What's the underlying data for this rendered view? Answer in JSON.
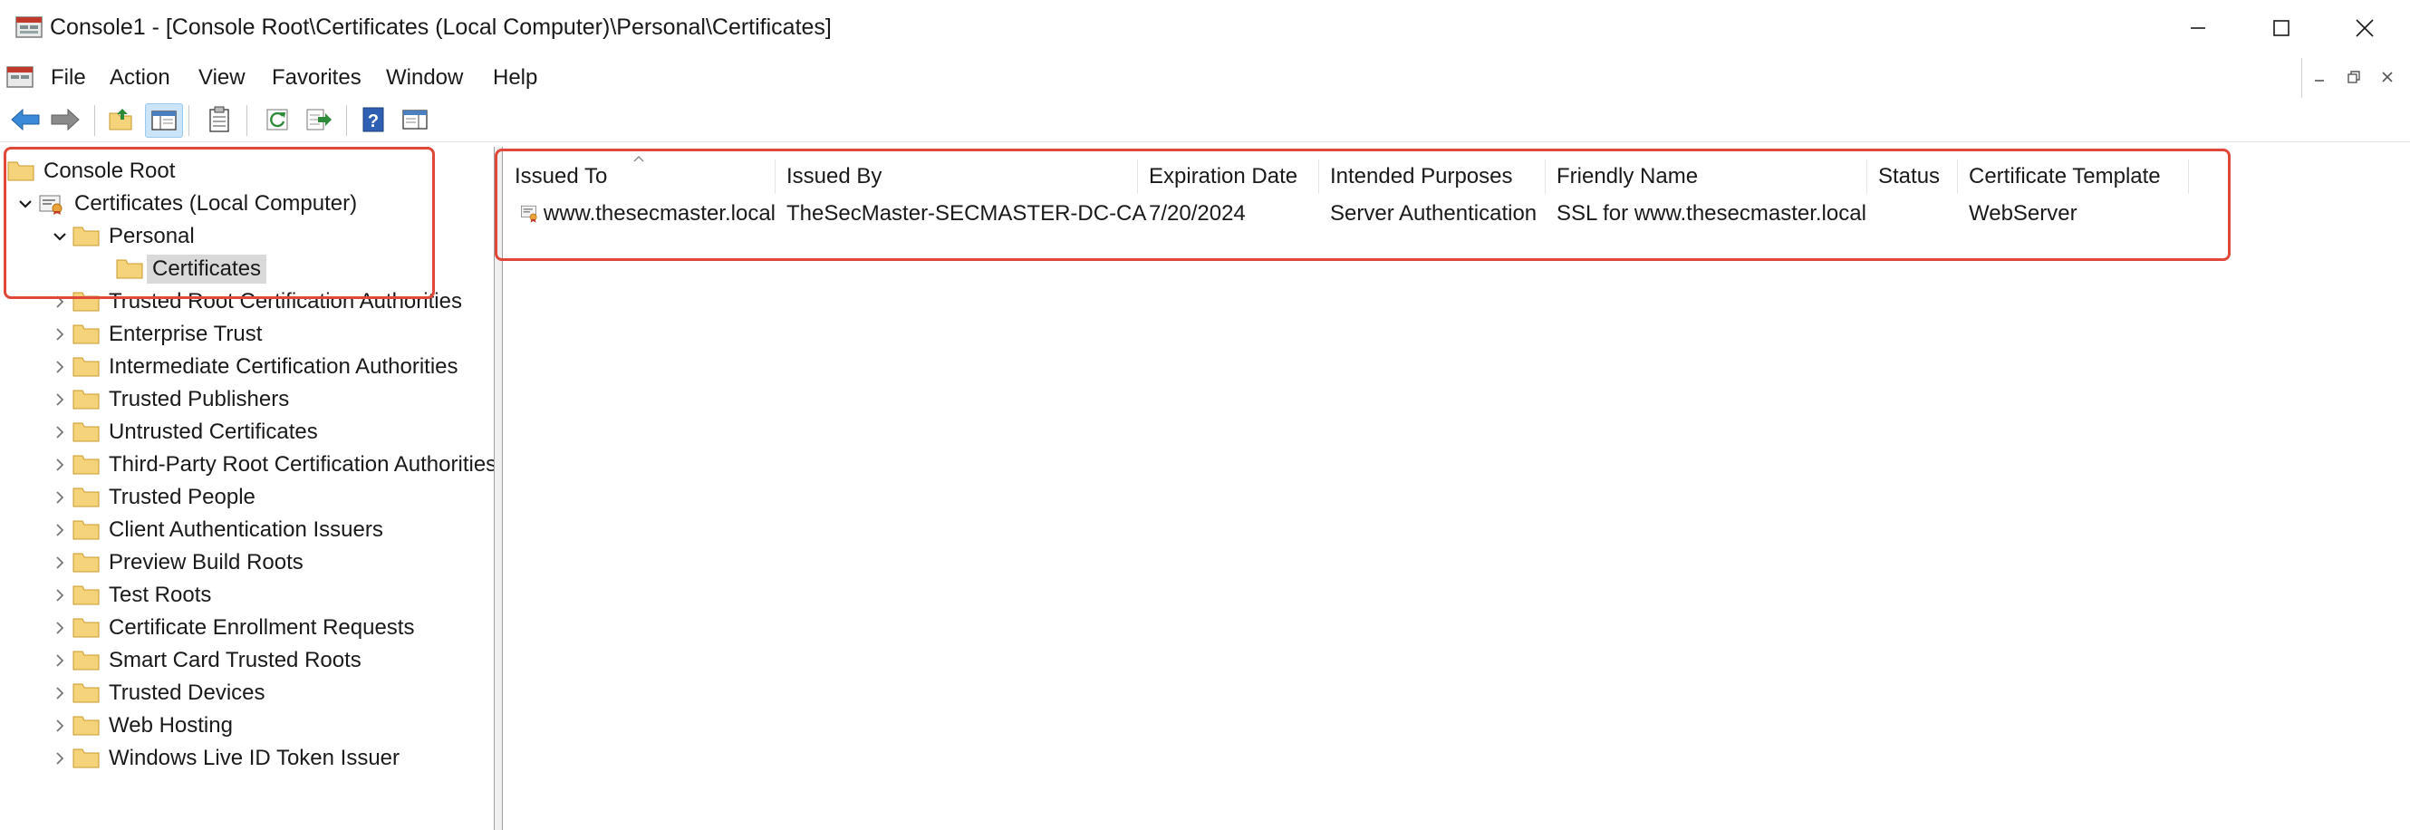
{
  "window": {
    "title": "Console1 - [Console Root\\Certificates (Local Computer)\\Personal\\Certificates]",
    "minimize_glyph": "—",
    "maximize_glyph": "☐",
    "close_glyph": "✕"
  },
  "menu": {
    "items": [
      "File",
      "Action",
      "View",
      "Favorites",
      "Window",
      "Help"
    ],
    "mdi_minimize": "–",
    "mdi_restore": "🗗",
    "mdi_close": "✕"
  },
  "toolbar": {
    "buttons": [
      "back-icon",
      "forward-icon",
      "up-folder-icon",
      "show-hide-tree-icon",
      "properties-icon",
      "refresh-icon",
      "export-list-icon",
      "help-icon",
      "show-hide-action-pane-icon"
    ]
  },
  "tree": {
    "root": "Console Root",
    "computer": "Certificates (Local Computer)",
    "personal": "Personal",
    "certificates": "Certificates",
    "stores": [
      "Trusted Root Certification Authorities",
      "Enterprise Trust",
      "Intermediate Certification Authorities",
      "Trusted Publishers",
      "Untrusted Certificates",
      "Third-Party Root Certification Authorities",
      "Trusted People",
      "Client Authentication Issuers",
      "Preview Build Roots",
      "Test Roots",
      "Certificate Enrollment Requests",
      "Smart Card Trusted Roots",
      "Trusted Devices",
      "Web Hosting",
      "Windows Live ID Token Issuer"
    ]
  },
  "list": {
    "columns": [
      "Issued To",
      "Issued By",
      "Expiration Date",
      "Intended Purposes",
      "Friendly Name",
      "Status",
      "Certificate Template"
    ],
    "rows": [
      {
        "issued_to": "www.thesecmaster.local",
        "issued_by": "TheSecMaster-SECMASTER-DC-CA",
        "expiration": "7/20/2024",
        "purposes": "Server Authentication",
        "friendly_name": "SSL for www.thesecmaster.local",
        "status": "",
        "template": "WebServer"
      }
    ]
  },
  "colors": {
    "annotation": "#e0483a",
    "folder": "#f5d37a",
    "selected_bg": "#d9d9d9",
    "toolbar_active": "#cce4f7"
  }
}
